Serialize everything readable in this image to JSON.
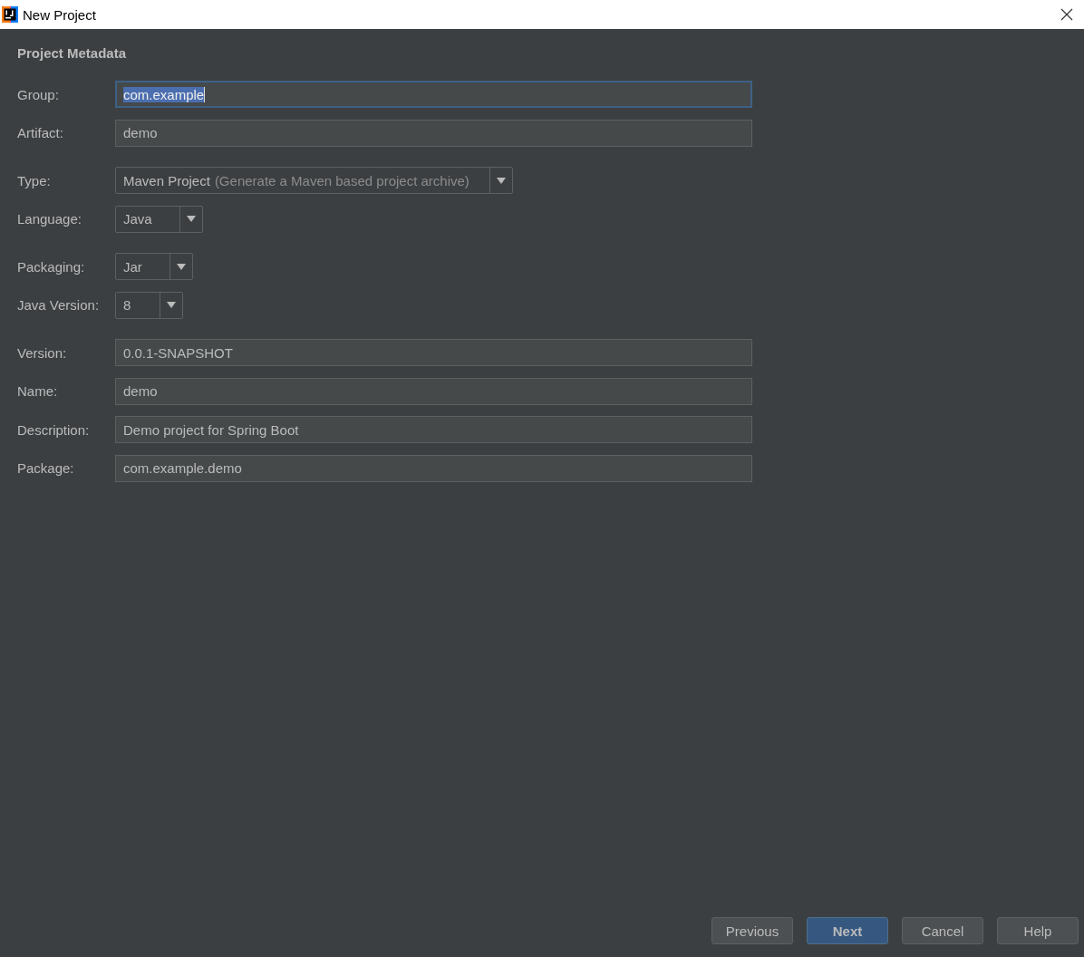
{
  "window": {
    "title": "New Project"
  },
  "section_title": "Project Metadata",
  "groups": [
    [
      {
        "kind": "text",
        "label": "Group:",
        "value": "com.example",
        "focused": true
      },
      {
        "kind": "text",
        "label": "Artifact:",
        "value": "demo",
        "focused": false
      }
    ],
    [
      {
        "kind": "select",
        "label": "Type:",
        "value": "Maven Project",
        "hint": "(Generate a Maven based project archive)"
      },
      {
        "kind": "select",
        "label": "Language:",
        "value": "Java"
      }
    ],
    [
      {
        "kind": "select",
        "label": "Packaging:",
        "value": "Jar"
      },
      {
        "kind": "select",
        "label": "Java Version:",
        "value": "8"
      }
    ],
    [
      {
        "kind": "text",
        "label": "Version:",
        "value": "0.0.1-SNAPSHOT",
        "focused": false
      },
      {
        "kind": "text",
        "label": "Name:",
        "value": "demo",
        "focused": false
      },
      {
        "kind": "text",
        "label": "Description:",
        "value": "Demo project for Spring Boot",
        "focused": false
      },
      {
        "kind": "text",
        "label": "Package:",
        "value": "com.example.demo",
        "focused": false
      }
    ]
  ],
  "buttons": [
    {
      "label": "Previous",
      "default": false
    },
    {
      "label": "Next",
      "default": true
    },
    {
      "label": "Cancel",
      "default": false
    },
    {
      "label": "Help",
      "default": false
    }
  ]
}
